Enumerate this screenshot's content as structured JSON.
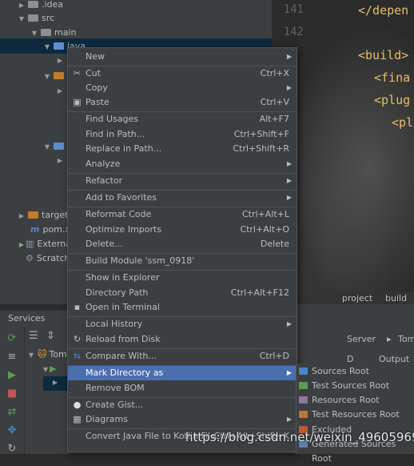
{
  "tree": {
    "rows": [
      {
        "indent": 1,
        "label": ".idea",
        "arrow": "▶"
      },
      {
        "indent": 1,
        "label": "src",
        "arrow": "▼"
      },
      {
        "indent": 2,
        "label": "main",
        "arrow": "▼"
      },
      {
        "indent": 3,
        "label": "java",
        "arrow": "▼"
      }
    ],
    "target_label": "target",
    "pom_label": "pom.x",
    "external_label": "External L",
    "scratches_label": "Scratches"
  },
  "editor": {
    "line_numbers": [
      "141",
      "142"
    ],
    "code_lines": [
      "</depen",
      "<build>",
      "<fina",
      "<plug",
      "<pl"
    ],
    "breadcrumb": [
      "project",
      "build"
    ]
  },
  "services": {
    "title": "Services",
    "tomcat_label": "Tom"
  },
  "right_panel": {
    "tabs": [
      "Server",
      "Tom"
    ],
    "output_label": "Output",
    "deploy_label": "D"
  },
  "context_menu": {
    "items": [
      {
        "label": "New",
        "shortcut": "",
        "submenu": true,
        "icon": ""
      },
      {
        "label": "Cut",
        "shortcut": "Ctrl+X",
        "submenu": false,
        "icon": "scissors-icon"
      },
      {
        "label": "Copy",
        "shortcut": "",
        "submenu": true,
        "icon": ""
      },
      {
        "label": "Paste",
        "shortcut": "Ctrl+V",
        "submenu": false,
        "icon": "clipboard-icon"
      },
      {
        "label": "Find Usages",
        "shortcut": "Alt+F7",
        "submenu": false,
        "icon": ""
      },
      {
        "label": "Find in Path...",
        "shortcut": "Ctrl+Shift+F",
        "submenu": false,
        "icon": ""
      },
      {
        "label": "Replace in Path...",
        "shortcut": "Ctrl+Shift+R",
        "submenu": false,
        "icon": ""
      },
      {
        "label": "Analyze",
        "shortcut": "",
        "submenu": true,
        "icon": ""
      },
      {
        "label": "Refactor",
        "shortcut": "",
        "submenu": true,
        "icon": ""
      },
      {
        "label": "Add to Favorites",
        "shortcut": "",
        "submenu": true,
        "icon": ""
      },
      {
        "label": "Reformat Code",
        "shortcut": "Ctrl+Alt+L",
        "submenu": false,
        "icon": ""
      },
      {
        "label": "Optimize Imports",
        "shortcut": "Ctrl+Alt+O",
        "submenu": false,
        "icon": ""
      },
      {
        "label": "Delete...",
        "shortcut": "Delete",
        "submenu": false,
        "icon": ""
      },
      {
        "label": "Build Module 'ssm_0918'",
        "shortcut": "",
        "submenu": false,
        "icon": ""
      },
      {
        "label": "Show in Explorer",
        "shortcut": "",
        "submenu": false,
        "icon": ""
      },
      {
        "label": "Directory Path",
        "shortcut": "Ctrl+Alt+F12",
        "submenu": false,
        "icon": ""
      },
      {
        "label": "Open in Terminal",
        "shortcut": "",
        "submenu": false,
        "icon": "terminal-icon"
      },
      {
        "label": "Local History",
        "shortcut": "",
        "submenu": true,
        "icon": ""
      },
      {
        "label": "Reload from Disk",
        "shortcut": "",
        "submenu": false,
        "icon": "reload-icon"
      },
      {
        "label": "Compare With...",
        "shortcut": "Ctrl+D",
        "submenu": false,
        "icon": "compare-icon"
      },
      {
        "label": "Mark Directory as",
        "shortcut": "",
        "submenu": true,
        "icon": "",
        "highlighted": true
      },
      {
        "label": "Remove BOM",
        "shortcut": "",
        "submenu": false,
        "icon": ""
      },
      {
        "label": "Create Gist...",
        "shortcut": "",
        "submenu": false,
        "icon": "github-icon"
      },
      {
        "label": "Diagrams",
        "shortcut": "",
        "submenu": true,
        "icon": "diagram-icon"
      },
      {
        "label": "Convert Java File to Kotlin File",
        "shortcut": "Ctrl+Alt+Shift+K",
        "submenu": false,
        "icon": ""
      }
    ]
  },
  "submenu": {
    "items": [
      {
        "label": "Sources Root",
        "color": "#4a86c8"
      },
      {
        "label": "Test Sources Root",
        "color": "#5b9b4f"
      },
      {
        "label": "Resources Root",
        "color": "#8a7a9e"
      },
      {
        "label": "Test Resources Root",
        "color": "#b87a3a"
      },
      {
        "label": "Excluded",
        "color": "#c0592f"
      },
      {
        "label": "Generated Sources Root",
        "color": "#5a7fa8"
      }
    ]
  },
  "watermark": "https://blog.csdn.net/weixin_49605969"
}
